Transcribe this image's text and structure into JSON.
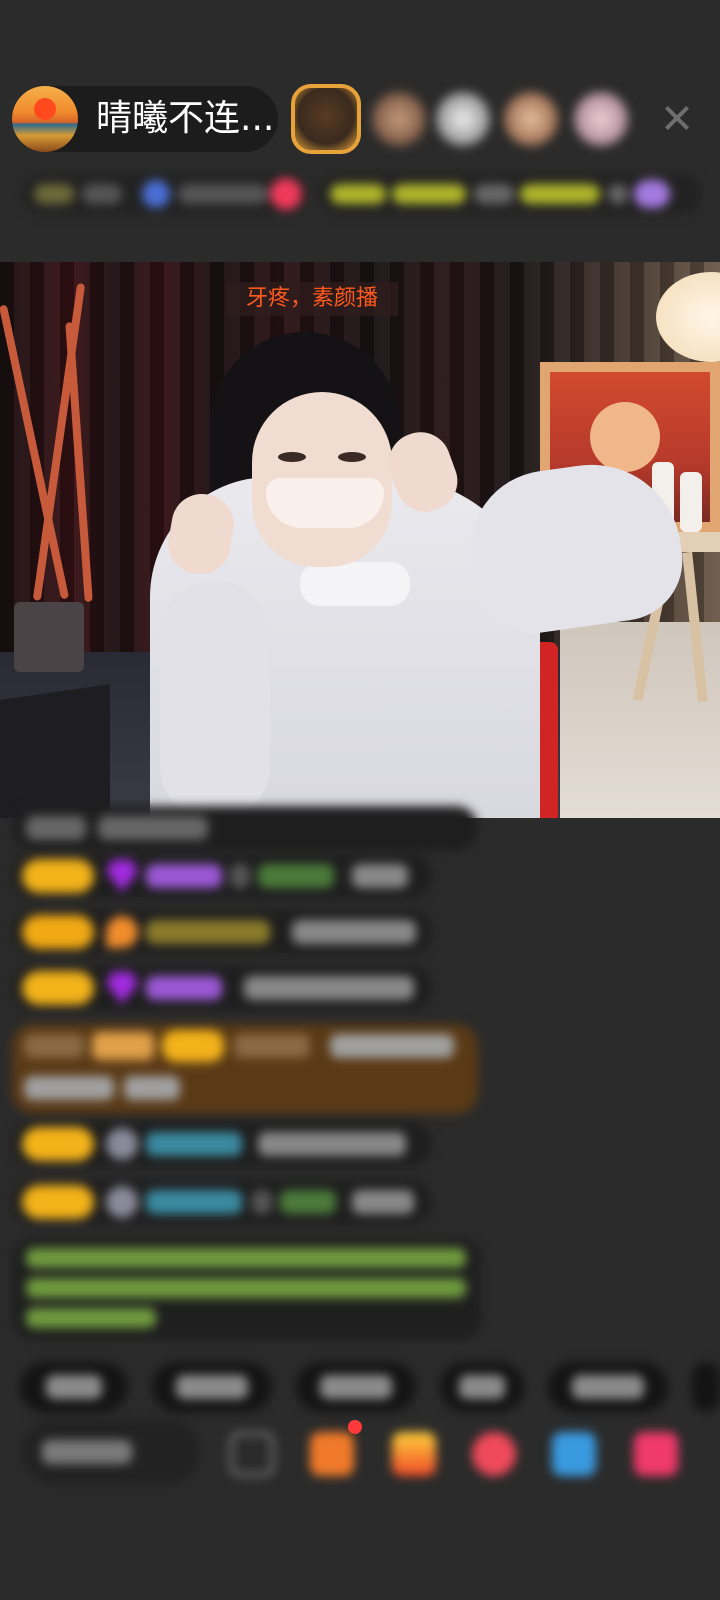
{
  "header": {
    "streamer_name": "晴曦不连..."
  },
  "stream": {
    "banner_text": "牙疼，素颜播"
  },
  "colors": {
    "background": "#2b2b2b",
    "banner_text": "#ff5a1e",
    "fan_badge": "#f2b21a",
    "gift_highlight": "#5a3a16",
    "notice_text": "#9bd05a",
    "close_icon": "#6e6e6e"
  },
  "icons": {
    "close": "close-icon",
    "chat_badges": [
      "purple-gem-icon",
      "orange-badge-icon",
      "grey-level-icon"
    ]
  }
}
